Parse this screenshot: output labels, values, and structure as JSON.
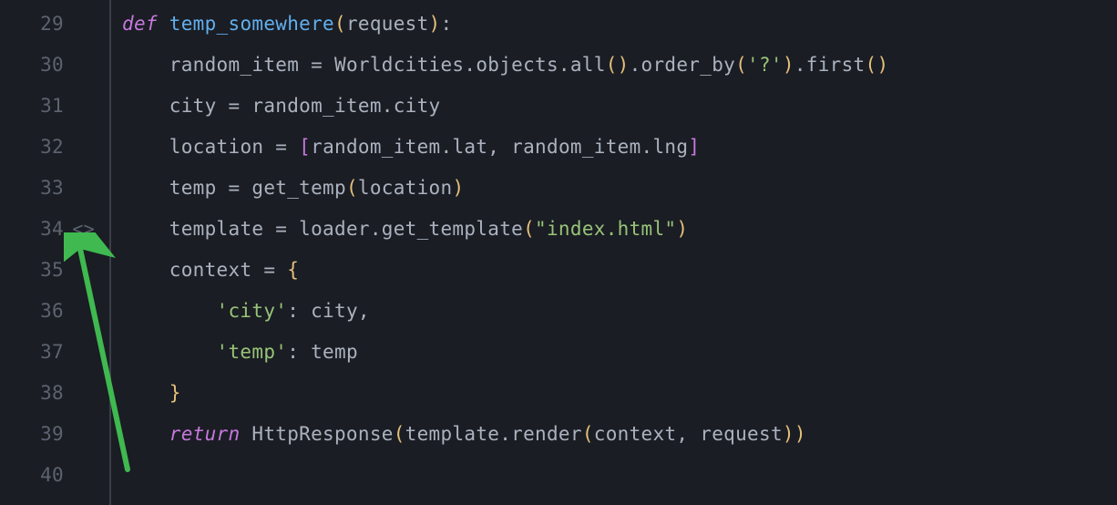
{
  "gutter": {
    "start": 29,
    "end": 40,
    "inline_marker_line": 34,
    "inline_marker": "<>"
  },
  "code": {
    "lines": [
      {
        "n": 29,
        "indent": 0,
        "tokens": [
          [
            "c-def",
            "def "
          ],
          [
            "c-func",
            "temp_somewhere"
          ],
          [
            "c-paren",
            "("
          ],
          [
            "c-plain",
            "request"
          ],
          [
            "c-paren",
            ")"
          ],
          [
            "c-punct",
            ":"
          ]
        ]
      },
      {
        "n": 30,
        "indent": 1,
        "tokens": [
          [
            "c-plain",
            "random_item "
          ],
          [
            "c-punct",
            "= "
          ],
          [
            "c-plain",
            "Worldcities.objects.all"
          ],
          [
            "c-paren",
            "()"
          ],
          [
            "c-plain",
            ".order_by"
          ],
          [
            "c-paren",
            "("
          ],
          [
            "c-string",
            "'?'"
          ],
          [
            "c-paren",
            ")"
          ],
          [
            "c-plain",
            ".first"
          ],
          [
            "c-paren",
            "()"
          ]
        ]
      },
      {
        "n": 31,
        "indent": 1,
        "tokens": [
          [
            "c-plain",
            "city "
          ],
          [
            "c-punct",
            "= "
          ],
          [
            "c-plain",
            "random_item.city"
          ]
        ]
      },
      {
        "n": 32,
        "indent": 1,
        "tokens": [
          [
            "c-plain",
            "location "
          ],
          [
            "c-punct",
            "= "
          ],
          [
            "c-bracket",
            "["
          ],
          [
            "c-plain",
            "random_item.lat"
          ],
          [
            "c-punct",
            ", "
          ],
          [
            "c-plain",
            "random_item.lng"
          ],
          [
            "c-bracket",
            "]"
          ]
        ]
      },
      {
        "n": 33,
        "indent": 1,
        "tokens": [
          [
            "c-plain",
            "temp "
          ],
          [
            "c-punct",
            "= "
          ],
          [
            "c-plain",
            "get_temp"
          ],
          [
            "c-paren",
            "("
          ],
          [
            "c-plain",
            "location"
          ],
          [
            "c-paren",
            ")"
          ]
        ]
      },
      {
        "n": 34,
        "indent": 1,
        "tokens": [
          [
            "c-plain",
            "template "
          ],
          [
            "c-punct",
            "= "
          ],
          [
            "c-plain",
            "loader.get_template"
          ],
          [
            "c-paren",
            "("
          ],
          [
            "c-string2",
            "\"index.html\""
          ],
          [
            "c-paren",
            ")"
          ]
        ]
      },
      {
        "n": 35,
        "indent": 1,
        "tokens": [
          [
            "c-plain",
            "context "
          ],
          [
            "c-punct",
            "= "
          ],
          [
            "c-brace",
            "{"
          ]
        ]
      },
      {
        "n": 36,
        "indent": 2,
        "tokens": [
          [
            "c-string",
            "'city'"
          ],
          [
            "c-punct",
            ": "
          ],
          [
            "c-plain",
            "city"
          ],
          [
            "c-punct",
            ","
          ]
        ]
      },
      {
        "n": 37,
        "indent": 2,
        "tokens": [
          [
            "c-string",
            "'temp'"
          ],
          [
            "c-punct",
            ": "
          ],
          [
            "c-plain",
            "temp"
          ]
        ]
      },
      {
        "n": 38,
        "indent": 1,
        "tokens": [
          [
            "c-brace",
            "}"
          ]
        ]
      },
      {
        "n": 39,
        "indent": 1,
        "tokens": [
          [
            "c-return",
            "return "
          ],
          [
            "c-plain",
            "HttpResponse"
          ],
          [
            "c-paren",
            "("
          ],
          [
            "c-plain",
            "template.render"
          ],
          [
            "c-paren",
            "("
          ],
          [
            "c-plain",
            "context"
          ],
          [
            "c-punct",
            ", "
          ],
          [
            "c-plain",
            "request"
          ],
          [
            "c-paren",
            "))"
          ]
        ]
      },
      {
        "n": 40,
        "indent": 0,
        "tokens": []
      }
    ]
  },
  "annotation": {
    "arrow_color": "#3fb950"
  }
}
